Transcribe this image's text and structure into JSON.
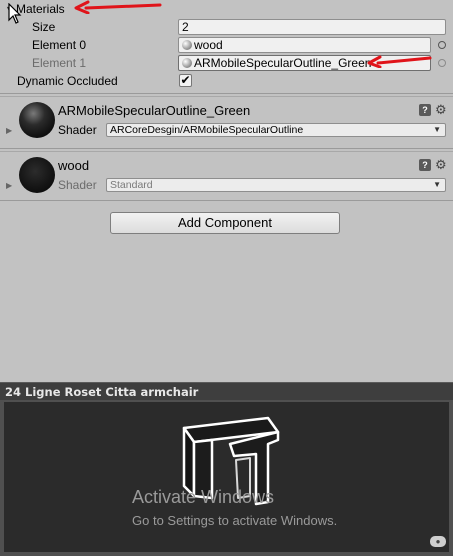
{
  "materials": {
    "header_label": "Materials",
    "size_label": "Size",
    "size_value": "2",
    "element0_label": "Element 0",
    "element0_value": "wood",
    "element1_label": "Element 1",
    "element1_value": "ARMobileSpecularOutline_Green"
  },
  "dynamic_occluded": {
    "label": "Dynamic Occluded",
    "checked": "✔"
  },
  "material_cards": [
    {
      "name": "ARMobileSpecularOutline_Green",
      "shader_label": "Shader",
      "shader_value": "ARCoreDesgin/ARMobileSpecularOutline"
    },
    {
      "name": "wood",
      "shader_label": "Shader",
      "shader_value": "Standard"
    }
  ],
  "add_component_label": "Add Component",
  "preview": {
    "title": "24 Ligne Roset Citta armchair",
    "watermark_title": "Activate Windows",
    "watermark_subtitle": "Go to Settings to activate Windows."
  },
  "colors": {
    "annotation_arrow": "#e0141a",
    "inspector_bg": "#c2c2c2",
    "preview_bg": "#2b2b2b"
  }
}
